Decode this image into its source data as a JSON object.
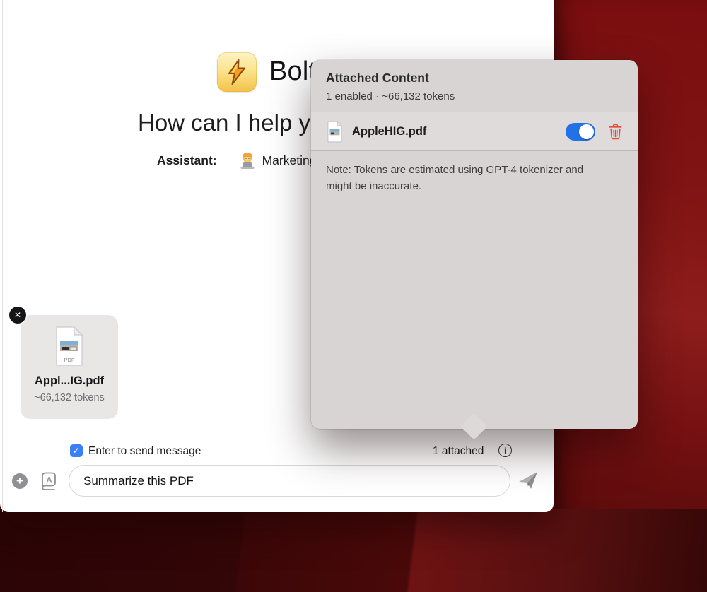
{
  "window": {
    "app_title": "Bolt",
    "greeting": "How can I help y",
    "assistant": {
      "label": "Assistant:",
      "name": "Marketing"
    }
  },
  "popover": {
    "title": "Attached Content",
    "summary": "1 enabled · ~66,132 tokens",
    "file": {
      "name": "AppleHIG.pdf",
      "enabled": true
    },
    "note": "Note: Tokens are estimated using GPT-4 tokenizer and might be inaccurate."
  },
  "attachment_card": {
    "filename": "Appl...IG.pdf",
    "tokens": "~66,132 tokens",
    "file_type_label": "PDF",
    "close_glyph": "✕"
  },
  "composer": {
    "enter_to_send_label": "Enter to send message",
    "attached_count": "1 attached",
    "message": "Summarize this PDF",
    "info_glyph": "i",
    "plus_glyph": "+",
    "check_glyph": "✓",
    "book_glyph": "A"
  },
  "colors": {
    "toggle_on": "#2271e8",
    "checkbox_on": "#3b7ff5",
    "trash_red": "#e8493b",
    "wallpaper_base": "#7a0f10"
  }
}
